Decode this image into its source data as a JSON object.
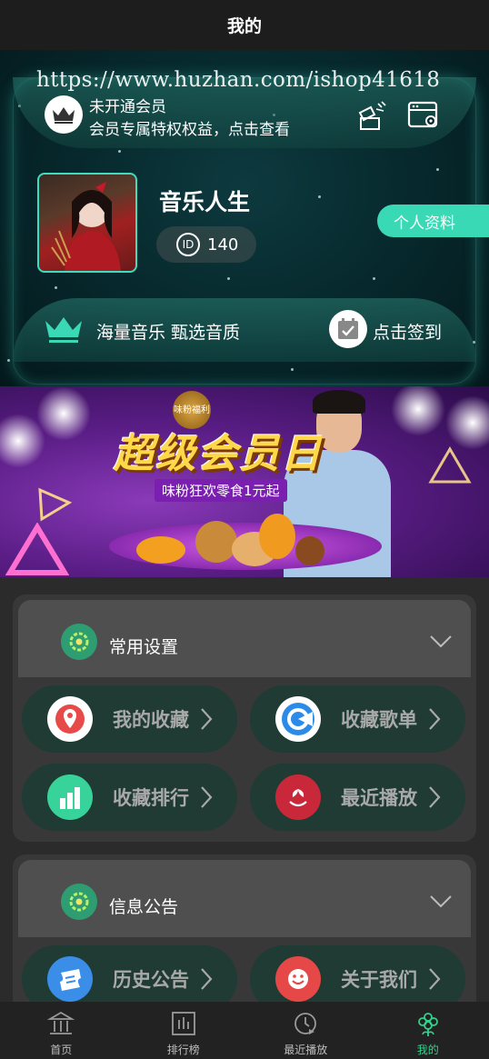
{
  "header": {
    "title": "我的"
  },
  "watermark": "https://www.huzhan.com/ishop41618",
  "vip": {
    "status": "未开通会员",
    "desc": "会员专属特权权益，点击查看"
  },
  "profile": {
    "name": "音乐人生",
    "id_label": "ID",
    "id_value": "140",
    "profile_button": "个人资料"
  },
  "bottom_band": {
    "slogan": "海量音乐 甄选音质",
    "checkin": "点击签到"
  },
  "promo": {
    "headline": "超级会员日",
    "badge": "味粉福利",
    "subline": "味粉狂欢零食1元起"
  },
  "sections": [
    {
      "title": "常用设置",
      "items": [
        {
          "label": "我的收藏",
          "icon": "location-pin-icon",
          "color": "#e84a4a"
        },
        {
          "label": "收藏歌单",
          "icon": "playlist-disc-icon",
          "color": "#2c8be8"
        },
        {
          "label": "收藏排行",
          "icon": "bar-chart-icon",
          "color": "#37d39a"
        },
        {
          "label": "最近播放",
          "icon": "recent-play-icon",
          "color": "#c8283a"
        }
      ]
    },
    {
      "title": "信息公告",
      "items": [
        {
          "label": "历史公告",
          "icon": "ticket-icon",
          "color": "#3a8ee8"
        },
        {
          "label": "关于我们",
          "icon": "smile-icon",
          "color": "#e64848"
        }
      ]
    }
  ],
  "tabbar": [
    {
      "label": "首页",
      "icon": "home-icon"
    },
    {
      "label": "排行榜",
      "icon": "ranking-icon"
    },
    {
      "label": "最近播放",
      "icon": "clock-play-icon"
    },
    {
      "label": "我的",
      "icon": "profile-flower-icon",
      "active": true
    }
  ],
  "colors": {
    "accent": "#3ad9b5",
    "active_tab": "#2fd38c",
    "tile_bg": "#1f3b33"
  }
}
